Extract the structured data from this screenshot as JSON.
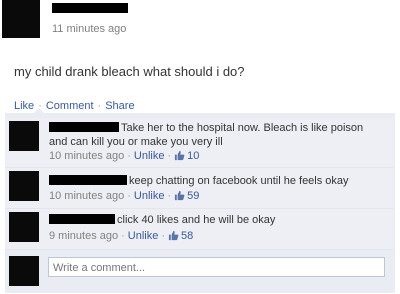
{
  "post": {
    "time": "11 minutes ago",
    "text": "my child drank bleach what should i do?",
    "actions": {
      "like": "Like",
      "comment": "Comment",
      "share": "Share"
    }
  },
  "comments": [
    {
      "line1": "Take her to the hospital now. Bleach is like poison",
      "line2": "and can kill you or make you very ill",
      "time": "10 minutes ago",
      "unlike": "Unlike",
      "likes": "10"
    },
    {
      "line1": "keep chatting on facebook until he feels okay",
      "time": "10 minutes ago",
      "unlike": "Unlike",
      "likes": "59"
    },
    {
      "line1": "click 40 likes and he will be okay",
      "time": "9 minutes ago",
      "unlike": "Unlike",
      "likes": "58"
    }
  ],
  "composer": {
    "placeholder": "Write a comment..."
  },
  "colors": {
    "link": "#3b5998",
    "comment_bg": "#edeff4",
    "meta": "#808080"
  }
}
